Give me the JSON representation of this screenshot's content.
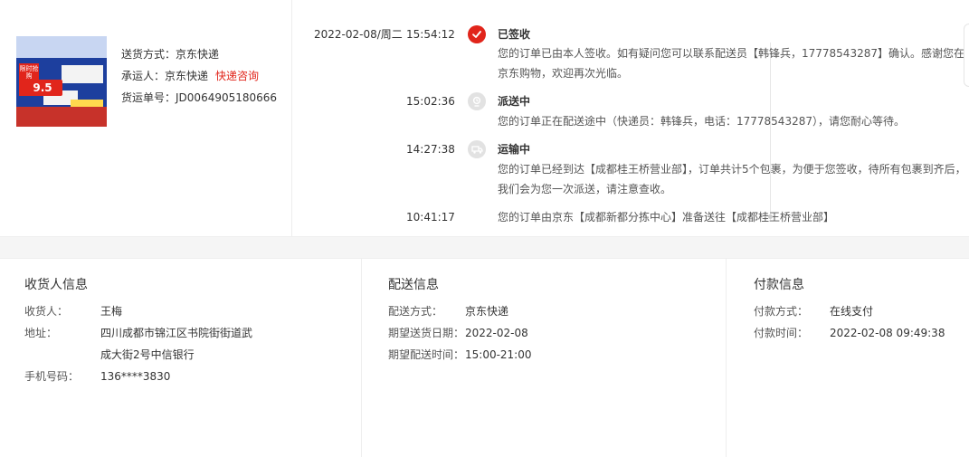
{
  "shipment": {
    "method_label": "送货方式：",
    "method_value": "京东快递",
    "carrier_label": "承运人：",
    "carrier_value": "京东快递",
    "consult_link": "快递咨询",
    "tracking_label": "货运单号：",
    "tracking_value": "JD0064905180666"
  },
  "product_image": {
    "badge_text": "限时抢购",
    "price_text": "9.5"
  },
  "timeline": [
    {
      "date": "2022-02-08/周二",
      "time": "15:54:12",
      "icon": "check-icon",
      "status": "已签收",
      "desc": "您的订单已由本人签收。如有疑问您可以联系配送员【韩锋兵，17778543287】确认。感谢您在京东购物，欢迎再次光临。"
    },
    {
      "date": "",
      "time": "15:02:36",
      "icon": "courier-icon",
      "status": "派送中",
      "desc": "您的订单正在配送途中（快递员：韩锋兵，电话：17778543287），请您耐心等待。"
    },
    {
      "date": "",
      "time": "14:27:38",
      "icon": "truck-icon",
      "status": "运输中",
      "desc": "您的订单已经到达【成都桂王桥营业部】，订单共计5个包裹，为便于您签收，待所有包裹到齐后，我们会为您一次派送，请注意查收。"
    },
    {
      "date": "",
      "time": "10:41:17",
      "icon": "dot",
      "status": "",
      "desc": "您的订单由京东【成都新都分拣中心】准备送往【成都桂王桥营业部】"
    }
  ],
  "receiver": {
    "title": "收货人信息",
    "name_label": "收货人：",
    "name_value": "王梅",
    "address_label": "地址：",
    "address_line1": "四川成都市锦江区书院街街道武",
    "address_line2": "成大街2号中信银行",
    "phone_label": "手机号码：",
    "phone_value": "136****3830"
  },
  "delivery": {
    "title": "配送信息",
    "method_label": "配送方式：",
    "method_value": "京东快递",
    "date_label": "期望送货日期：",
    "date_value": "2022-02-08",
    "time_label": "期望配送时间：",
    "time_value": "15:00-21:00"
  },
  "payment": {
    "title": "付款信息",
    "method_label": "付款方式：",
    "method_value": "在线支付",
    "time_label": "付款时间：",
    "time_value": "2022-02-08 09:49:38"
  },
  "colors": {
    "accent_red": "#e1251b",
    "icon_grey": "#e2e2e2"
  }
}
